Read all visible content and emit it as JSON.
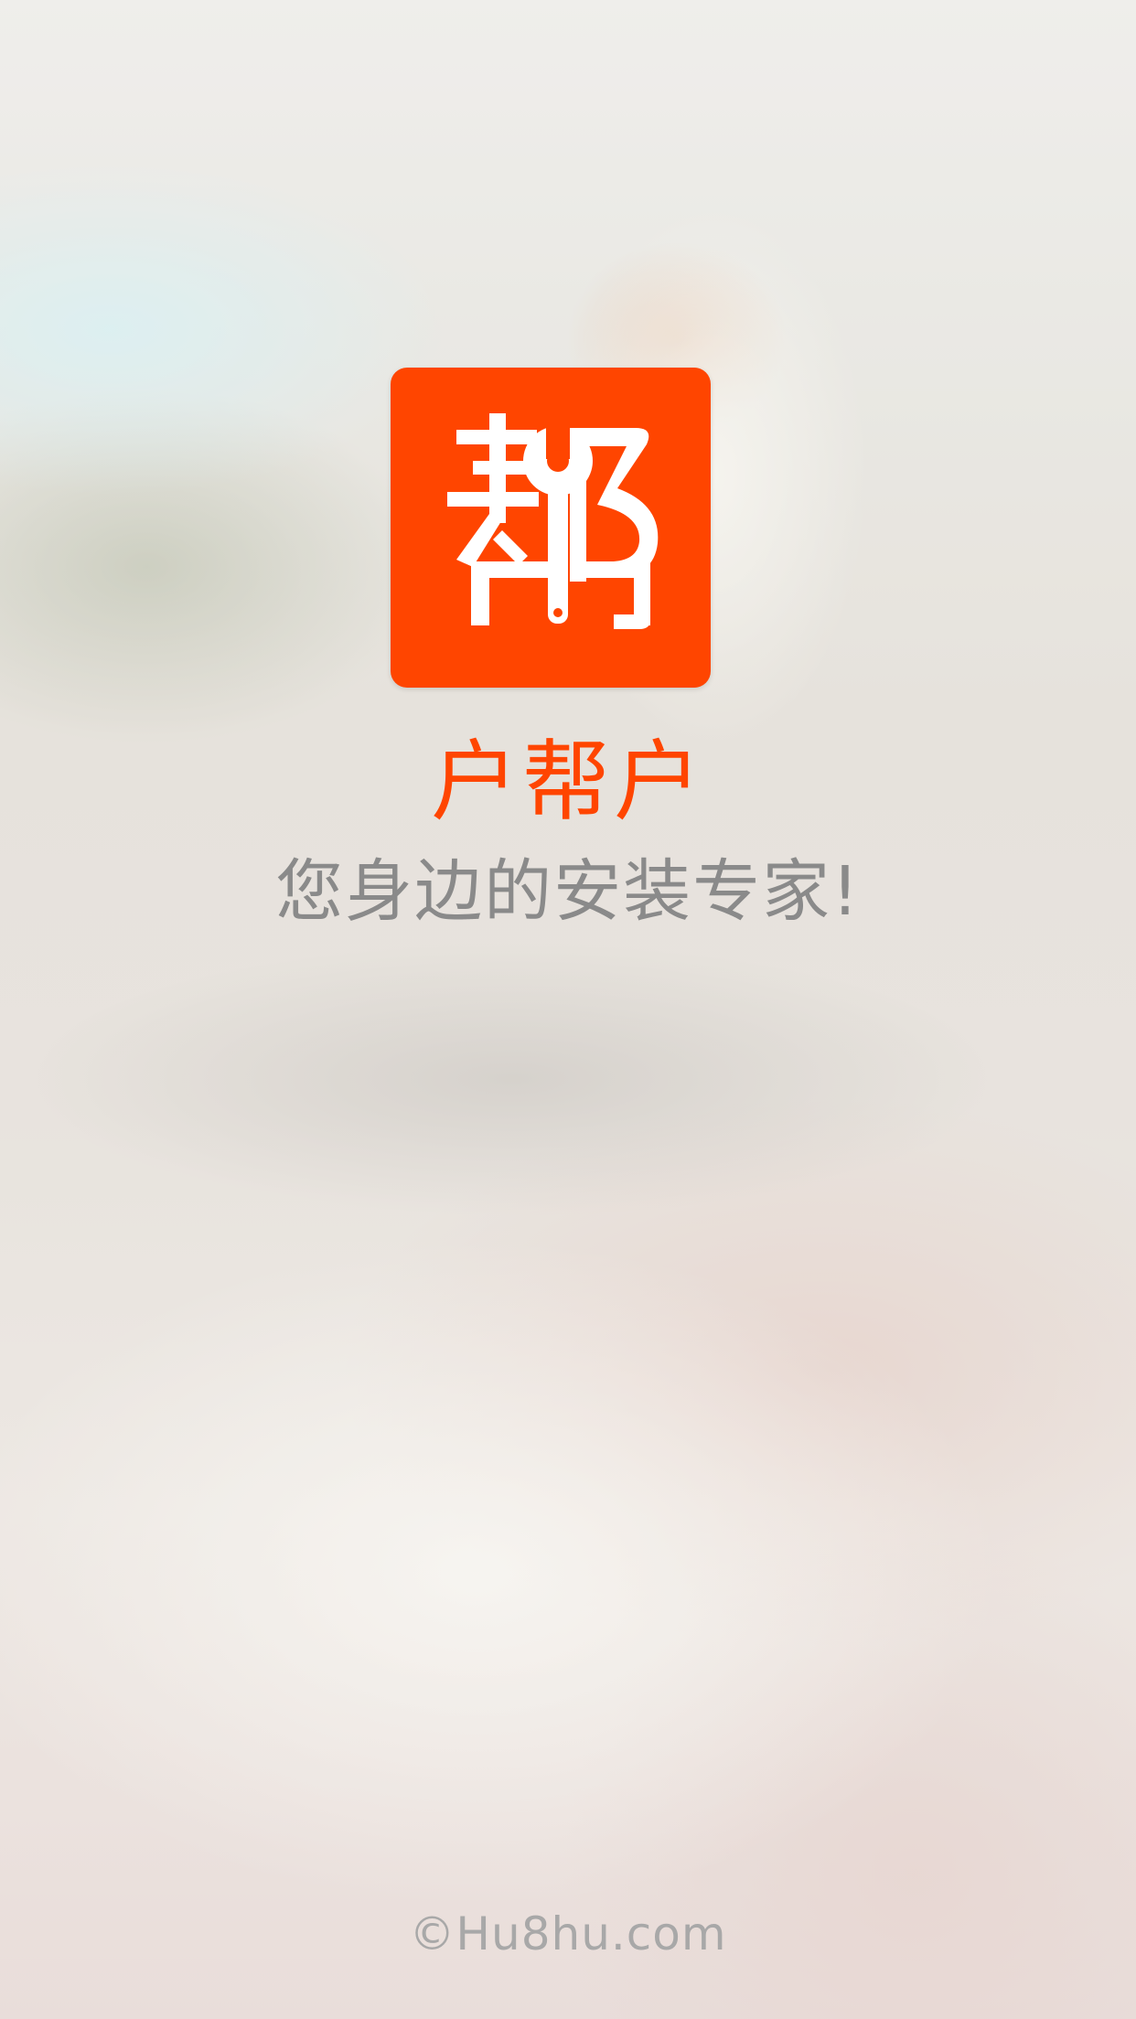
{
  "app": {
    "name": "户帮户",
    "slogan": "您身边的安装专家!",
    "copyright": "©Hu8hu.com"
  },
  "logo": {
    "glyph": "帮",
    "background_color": "#ff4500",
    "foreground_color": "#ffffff",
    "icon": "wrench-icon"
  },
  "colors": {
    "brand": "#ff4500",
    "slogan_text": "#8a8a8a",
    "footer_text": "#a8a8a8"
  }
}
